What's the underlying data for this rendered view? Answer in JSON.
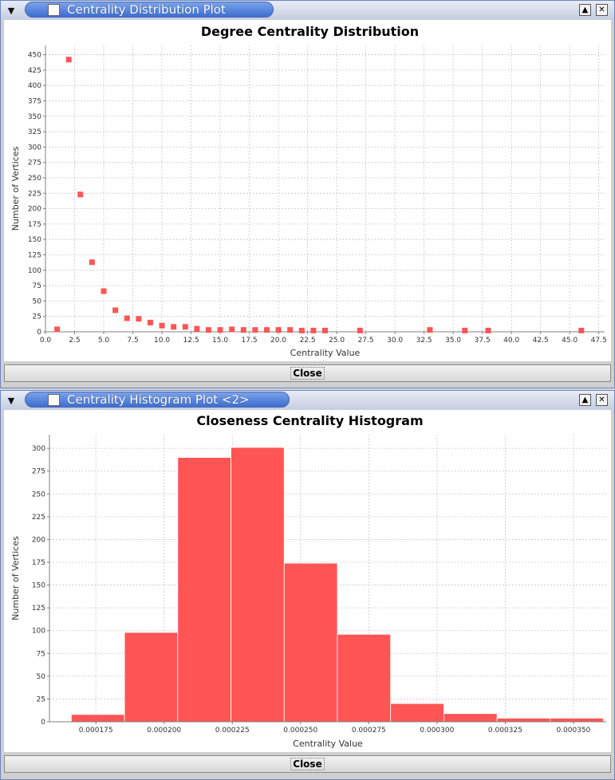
{
  "window1": {
    "title": "Centrality Distribution Plot",
    "close_label": "Close"
  },
  "window2": {
    "title": "Centrality Histogram Plot <2>",
    "close_label": "Close"
  },
  "colors": {
    "series": "#ff5555",
    "titlebar": "#3e6ed0"
  },
  "chart_data": [
    {
      "type": "scatter",
      "title": "Degree Centrality Distribution",
      "xlabel": "Centrality Value",
      "ylabel": "Number of Vertices",
      "xlim": [
        0,
        48
      ],
      "ylim": [
        0,
        465
      ],
      "xticks": [
        0.0,
        2.5,
        5.0,
        7.5,
        10.0,
        12.5,
        15.0,
        17.5,
        20.0,
        22.5,
        25.0,
        27.5,
        30.0,
        32.5,
        35.0,
        37.5,
        40.0,
        42.5,
        45.0,
        47.5
      ],
      "xtick_labels": [
        "0.0",
        "2.5",
        "5.0",
        "7.5",
        "10.0",
        "12.5",
        "15.0",
        "17.5",
        "20.0",
        "22.5",
        "25.0",
        "27.5",
        "30.0",
        "32.5",
        "35.0",
        "37.5",
        "40.0",
        "42.5",
        "45.0",
        "47.5"
      ],
      "yticks": [
        0,
        25,
        50,
        75,
        100,
        125,
        150,
        175,
        200,
        225,
        250,
        275,
        300,
        325,
        350,
        375,
        400,
        425,
        450
      ],
      "grid": true,
      "points": [
        [
          1,
          4
        ],
        [
          2,
          442
        ],
        [
          3,
          223
        ],
        [
          4,
          113
        ],
        [
          5,
          66
        ],
        [
          6,
          35
        ],
        [
          7,
          22
        ],
        [
          8,
          21
        ],
        [
          9,
          15
        ],
        [
          10,
          10
        ],
        [
          11,
          8
        ],
        [
          12,
          8
        ],
        [
          13,
          5
        ],
        [
          14,
          3
        ],
        [
          15,
          3
        ],
        [
          16,
          4
        ],
        [
          17,
          3
        ],
        [
          18,
          3
        ],
        [
          19,
          3
        ],
        [
          20,
          3
        ],
        [
          21,
          3
        ],
        [
          22,
          2
        ],
        [
          23,
          2
        ],
        [
          24,
          2
        ],
        [
          27,
          2
        ],
        [
          33,
          3
        ],
        [
          36,
          2
        ],
        [
          38,
          2
        ],
        [
          46,
          2
        ]
      ]
    },
    {
      "type": "bar",
      "title": "Closeness Centrality Histogram",
      "xlabel": "Centrality Value",
      "ylabel": "Number of Vertices",
      "xlim": [
        0.000158,
        0.000362
      ],
      "ylim": [
        0,
        315
      ],
      "xticks": [
        0.000175,
        0.0002,
        0.000225,
        0.00025,
        0.000275,
        0.0003,
        0.000325,
        0.00035
      ],
      "xtick_labels": [
        "0.000175",
        "0.000200",
        "0.000225",
        "0.000250",
        "0.000275",
        "0.000300",
        "0.000325",
        "0.000350"
      ],
      "yticks": [
        0,
        25,
        50,
        75,
        100,
        125,
        150,
        175,
        200,
        225,
        250,
        275,
        300
      ],
      "grid": true,
      "bins": [
        {
          "start": 0.000166,
          "end": 0.0001855,
          "value": 8
        },
        {
          "start": 0.0001855,
          "end": 0.000205,
          "value": 98
        },
        {
          "start": 0.000205,
          "end": 0.0002245,
          "value": 290
        },
        {
          "start": 0.0002245,
          "end": 0.000244,
          "value": 301
        },
        {
          "start": 0.000244,
          "end": 0.0002635,
          "value": 174
        },
        {
          "start": 0.0002635,
          "end": 0.000283,
          "value": 96
        },
        {
          "start": 0.000283,
          "end": 0.0003025,
          "value": 20
        },
        {
          "start": 0.0003025,
          "end": 0.000322,
          "value": 9
        },
        {
          "start": 0.000322,
          "end": 0.0003415,
          "value": 4
        },
        {
          "start": 0.0003415,
          "end": 0.000361,
          "value": 4
        }
      ]
    }
  ]
}
